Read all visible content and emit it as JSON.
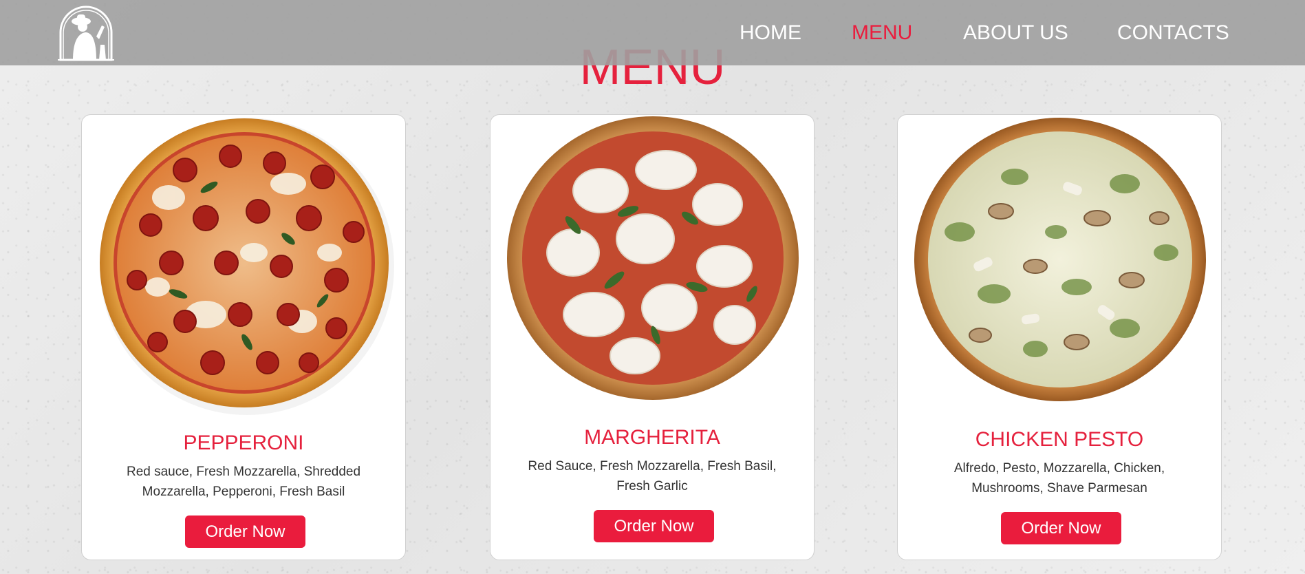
{
  "nav": {
    "items": [
      {
        "label": "HOME",
        "active": false
      },
      {
        "label": "MENU",
        "active": true
      },
      {
        "label": "ABOUT US",
        "active": false
      },
      {
        "label": "CONTACTS",
        "active": false
      }
    ]
  },
  "page": {
    "title": "MENU"
  },
  "menu": {
    "items": [
      {
        "name": "PEPPERONI",
        "description": "Red sauce, Fresh Mozzarella, Shredded Mozzarella, Pepperoni, Fresh Basil",
        "button_label": "Order Now",
        "image": "pepperoni-pizza-image"
      },
      {
        "name": "MARGHERITA",
        "description": "Red Sauce, Fresh Mozzarella, Fresh Basil, Fresh Garlic",
        "button_label": "Order Now",
        "image": "margherita-pizza-image"
      },
      {
        "name": "CHICKEN PESTO",
        "description": "Alfredo, Pesto, Mozzarella, Chicken, Mushrooms, Shave Parmesan",
        "button_label": "Order Now",
        "image": "chicken-pesto-pizza-image"
      }
    ]
  },
  "colors": {
    "accent": "#ea1c3d",
    "header_bg": "#a0a0a0",
    "card_bg": "#ffffff"
  }
}
